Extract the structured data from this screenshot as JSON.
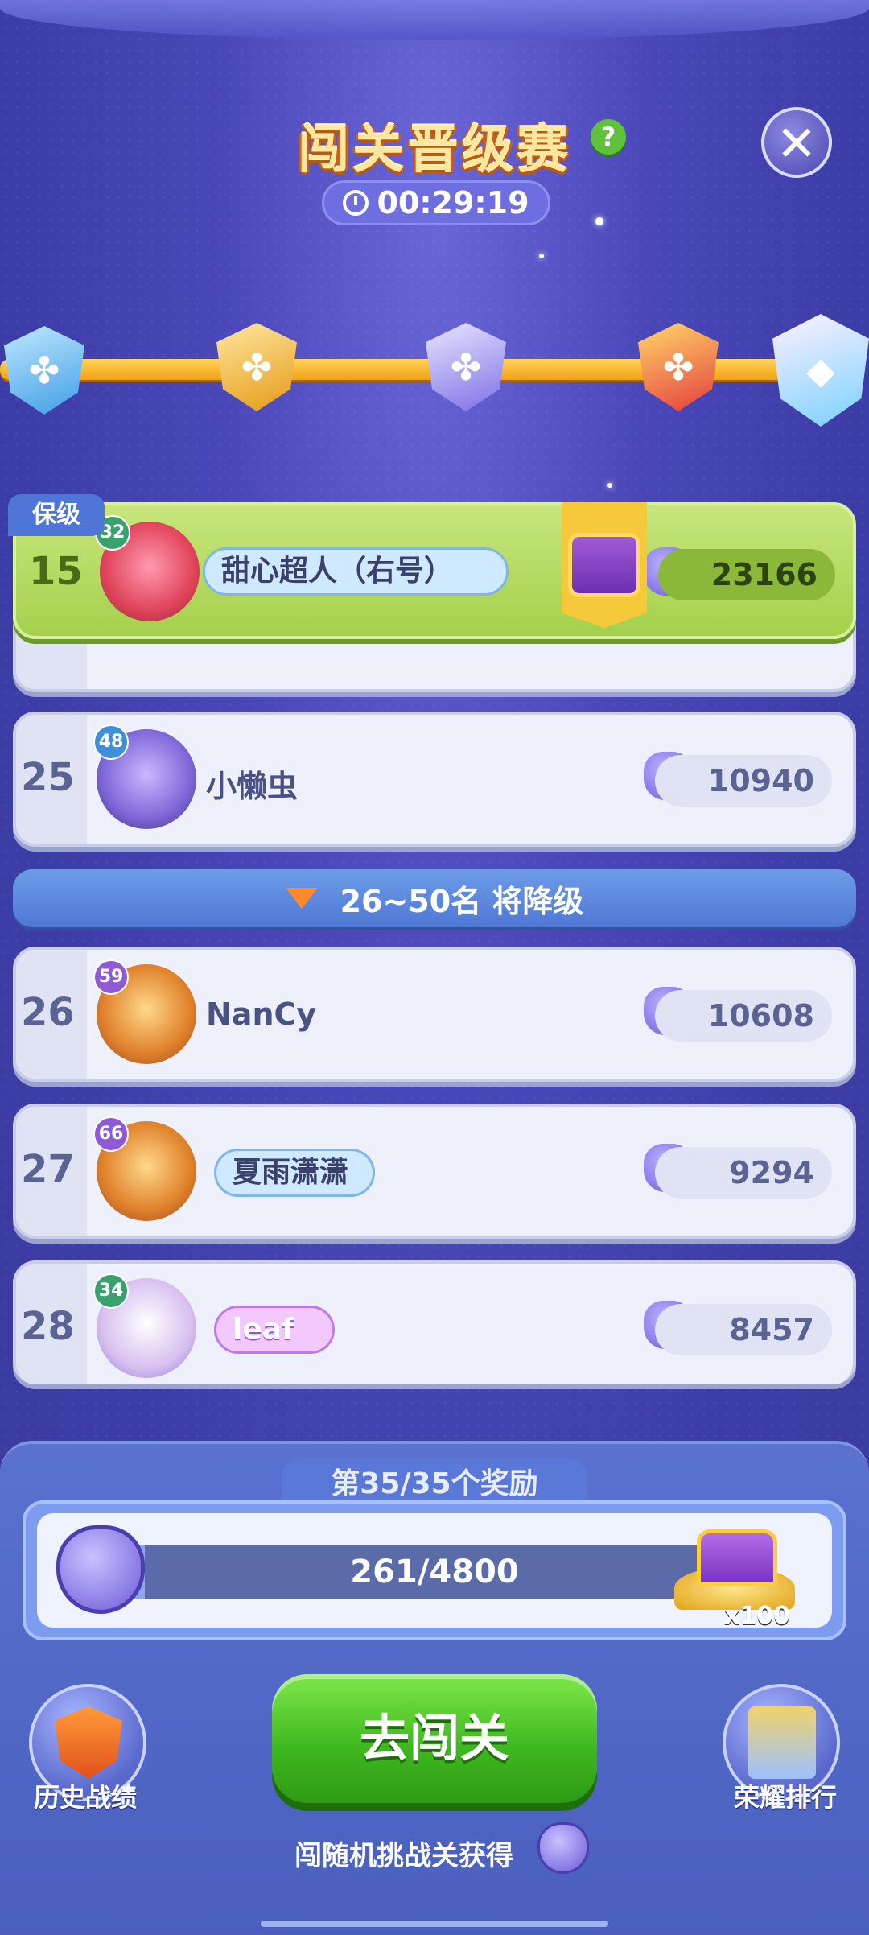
{
  "header": {
    "title": "闯关晋级赛",
    "timer": "00:29:19"
  },
  "tiers": [
    "blue",
    "gold",
    "purple",
    "red",
    "diamond"
  ],
  "leaderboard": {
    "highlight": {
      "tag": "保级",
      "rank": "15",
      "level": "32",
      "name": "甜心超人（右号）",
      "score": "23166"
    },
    "rows": [
      {
        "rank": "25",
        "level": "48",
        "name": "小懒虫",
        "score": "10940"
      },
      {
        "rank": "26",
        "level": "59",
        "name": "NanCy",
        "score": "10608"
      },
      {
        "rank": "27",
        "level": "66",
        "name": "夏雨潇潇",
        "score": "9294"
      },
      {
        "rank": "28",
        "level": "34",
        "name": "leaf",
        "score": "8457"
      }
    ],
    "demote_banner": "26~50名 将降级"
  },
  "reward": {
    "title": "第35/35个奖励",
    "progress_text": "261/4800",
    "progress_fraction": 0.054,
    "prize_count": "x100"
  },
  "buttons": {
    "go": "去闯关",
    "history": "历史战绩",
    "ranking": "荣耀排行"
  },
  "hint": "闯随机挑战关获得"
}
